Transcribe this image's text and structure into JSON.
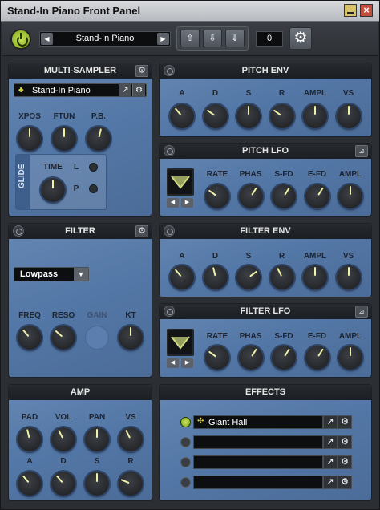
{
  "window": {
    "title": "Stand-In Piano Front Panel",
    "close_glyph": "×"
  },
  "toolbar": {
    "preset_name": "Stand-In Piano",
    "prev_glyph": "◀",
    "next_glyph": "▶",
    "upload_glyph": "⇧",
    "download_glyph": "⇩",
    "save_glyph": "⇓",
    "number_value": "0",
    "settings_glyph": "⚙"
  },
  "multisampler": {
    "title": "MULTI-SAMPLER",
    "instrument": "Stand-In Piano",
    "instrument_icon": "piano-icon",
    "knobs": [
      {
        "label": "XPOS",
        "value": 0.5
      },
      {
        "label": "FTUN",
        "value": 0.5
      },
      {
        "label": "P.B.",
        "value": 0.55
      }
    ],
    "glide": {
      "label": "GLIDE",
      "time_label": "TIME",
      "time_value": 0.5,
      "l_label": "L",
      "p_label": "P"
    }
  },
  "pitch_env": {
    "title": "PITCH ENV",
    "knobs": [
      {
        "label": "A",
        "value": 0.35
      },
      {
        "label": "D",
        "value": 0.3
      },
      {
        "label": "S",
        "value": 0.5
      },
      {
        "label": "R",
        "value": 0.3
      },
      {
        "label": "AMPL",
        "value": 0.5
      },
      {
        "label": "VS",
        "value": 0.5
      }
    ]
  },
  "pitch_lfo": {
    "title": "PITCH LFO",
    "wave_glyph": "⊿",
    "knobs": [
      {
        "label": "RATE",
        "value": 0.3
      },
      {
        "label": "PHAS",
        "value": 0.62
      },
      {
        "label": "S-FD",
        "value": 0.62
      },
      {
        "label": "E-FD",
        "value": 0.62
      },
      {
        "label": "AMPL",
        "value": 0.5
      }
    ]
  },
  "filter": {
    "title": "FILTER",
    "mode": "Lowpass",
    "knobs": [
      {
        "label": "FREQ",
        "value": 0.35
      },
      {
        "label": "RESO",
        "value": 0.32
      },
      {
        "label": "GAIN",
        "value": null
      },
      {
        "label": "KT",
        "value": 0.5
      }
    ]
  },
  "filter_env": {
    "title": "FILTER ENV",
    "knobs": [
      {
        "label": "A",
        "value": 0.35
      },
      {
        "label": "D",
        "value": 0.45
      },
      {
        "label": "S",
        "value": 0.7
      },
      {
        "label": "R",
        "value": 0.4
      },
      {
        "label": "AMPL",
        "value": 0.5
      },
      {
        "label": "VS",
        "value": 0.5
      }
    ]
  },
  "filter_lfo": {
    "title": "FILTER LFO",
    "wave_glyph": "⊿",
    "knobs": [
      {
        "label": "RATE",
        "value": 0.3
      },
      {
        "label": "PHAS",
        "value": 0.62
      },
      {
        "label": "S-FD",
        "value": 0.62
      },
      {
        "label": "E-FD",
        "value": 0.62
      },
      {
        "label": "AMPL",
        "value": 0.5
      }
    ]
  },
  "amp": {
    "title": "AMP",
    "knobs": [
      {
        "label": "PAD",
        "value": 0.45
      },
      {
        "label": "VOL",
        "value": 0.4
      },
      {
        "label": "PAN",
        "value": 0.5
      },
      {
        "label": "VS",
        "value": 0.4
      },
      {
        "label": "A",
        "value": 0.35
      },
      {
        "label": "D",
        "value": 0.35
      },
      {
        "label": "S",
        "value": 0.5
      },
      {
        "label": "R",
        "value": 0.25
      }
    ]
  },
  "effects": {
    "title": "EFFECTS",
    "slots": [
      {
        "name": "Giant Hall",
        "active": true
      },
      {
        "name": "",
        "active": false
      },
      {
        "name": "",
        "active": false
      },
      {
        "name": "",
        "active": false
      }
    ]
  },
  "colors": {
    "accent": "#9fc83a",
    "panel": "#5a7eae",
    "knob_indicator": "#f0f2a8"
  }
}
